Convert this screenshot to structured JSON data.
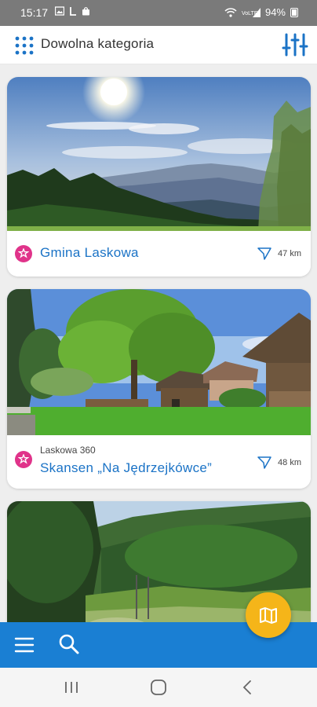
{
  "status_bar": {
    "time": "15:17",
    "left_icons": [
      "image-icon",
      "lock-screen-icon",
      "shopping-bag-icon"
    ],
    "right_icons": [
      "wifi-icon",
      "signal-icon"
    ],
    "battery": "94%"
  },
  "top_bar": {
    "title": "Dowolna kategoria",
    "grid_icon": "grid-icon",
    "filter_icon": "filter-sliders-icon",
    "accent": "#1b73c6"
  },
  "cards": [
    {
      "subtitle": "",
      "title": "Gmina Laskowa",
      "distance": "47 km",
      "photo": "mountain-panorama"
    },
    {
      "subtitle": "Laskowa 360",
      "title": "Skansen „Na Jędrzejkówce”",
      "distance": "48 km",
      "photo": "open-air-museum"
    },
    {
      "subtitle": "",
      "title": "",
      "distance": "",
      "photo": "forest-valley"
    }
  ],
  "bottom_bar": {
    "menu_icon": "hamburger-menu-icon",
    "search_icon": "search-icon",
    "map_fab_icon": "map-icon",
    "color": "#1a7fd3",
    "fab_color": "#f5b519"
  },
  "nav_bar": {
    "icons": [
      "recent-apps-icon",
      "home-icon",
      "back-icon"
    ]
  }
}
